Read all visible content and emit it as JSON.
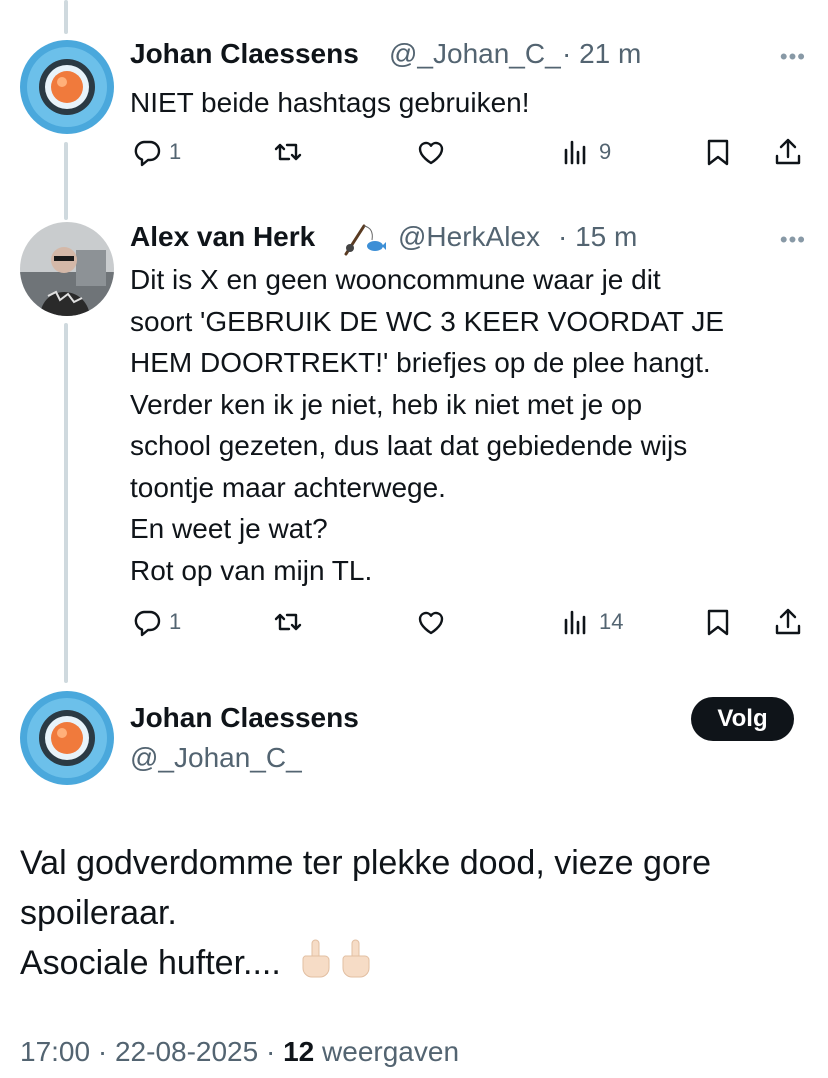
{
  "reply1": {
    "author": "Johan Claessens",
    "handle": "@_Johan_C_",
    "time": "· 21 m",
    "text": "NIET beide hashtags gebruiken!",
    "actions": {
      "replies": "1",
      "views": "9"
    },
    "more": "•••"
  },
  "reply2": {
    "author": "Alex van Herk",
    "handle": "@HerkAlex",
    "time": "· 15 m",
    "lines": [
      "Dit is X en geen wooncommune waar je dit",
      "soort 'GEBRUIK DE WC 3 KEER VOORDAT JE",
      "HEM DOORTREKT!' briefjes op de plee hangt.",
      "Verder ken ik je niet, heb ik niet met je op",
      "school gezeten, dus laat dat gebiedende wijs",
      "toontje maar achterwege.",
      "En weet je wat?",
      "Rot op van mijn TL."
    ],
    "actions": {
      "replies": "1",
      "views": "14"
    },
    "more": "•••"
  },
  "main": {
    "author": "Johan Claessens",
    "handle": "@_Johan_C_",
    "follow_label": "Volg",
    "lines": [
      "Val godverdomme ter plekke dood, vieze gore",
      "spoileraar.",
      "Asociale hufter...."
    ],
    "emoji": [
      "middle-finger-emoji",
      "middle-finger-emoji"
    ],
    "footer": {
      "time": "17:00",
      "sep": "·",
      "date": "22-08-2025",
      "views_count": "12",
      "views_label": "weergaven"
    }
  },
  "colors": {
    "text": "#0f1419",
    "muted": "#536471",
    "thread_line": "#cfd9de",
    "button_bg": "#0f1419"
  }
}
